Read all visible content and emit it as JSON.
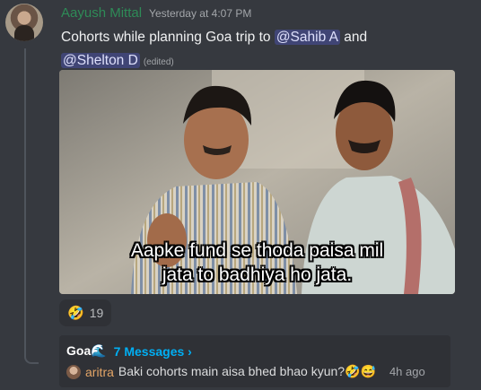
{
  "message": {
    "author": "Aayush Mittal",
    "timestamp": "Yesterday at 4:07 PM",
    "text_before": "Cohorts while planning Goa trip to ",
    "mention_1": "@Sahib A",
    "text_between": " and",
    "mention_2": "@Shelton D",
    "edited_label": "(edited)",
    "meme_caption_line1": "Aapke fund se thoda paisa mil",
    "meme_caption_line2": "jata to badhiya ho jata.",
    "reaction": {
      "emoji": "🤣",
      "count": "19"
    }
  },
  "thread": {
    "name": "Goa🌊",
    "messages_link": "7 Messages ›",
    "last_author": "aritra",
    "last_message": "Baki cohorts main aisa bhed bhao kyun?🤣😅",
    "last_time": "4h ago"
  },
  "colors": {
    "background": "#36393f",
    "username": "#2e8b57",
    "mention_bg": "#3c4270",
    "link": "#00aff4",
    "thread_author": "#e3a567"
  }
}
